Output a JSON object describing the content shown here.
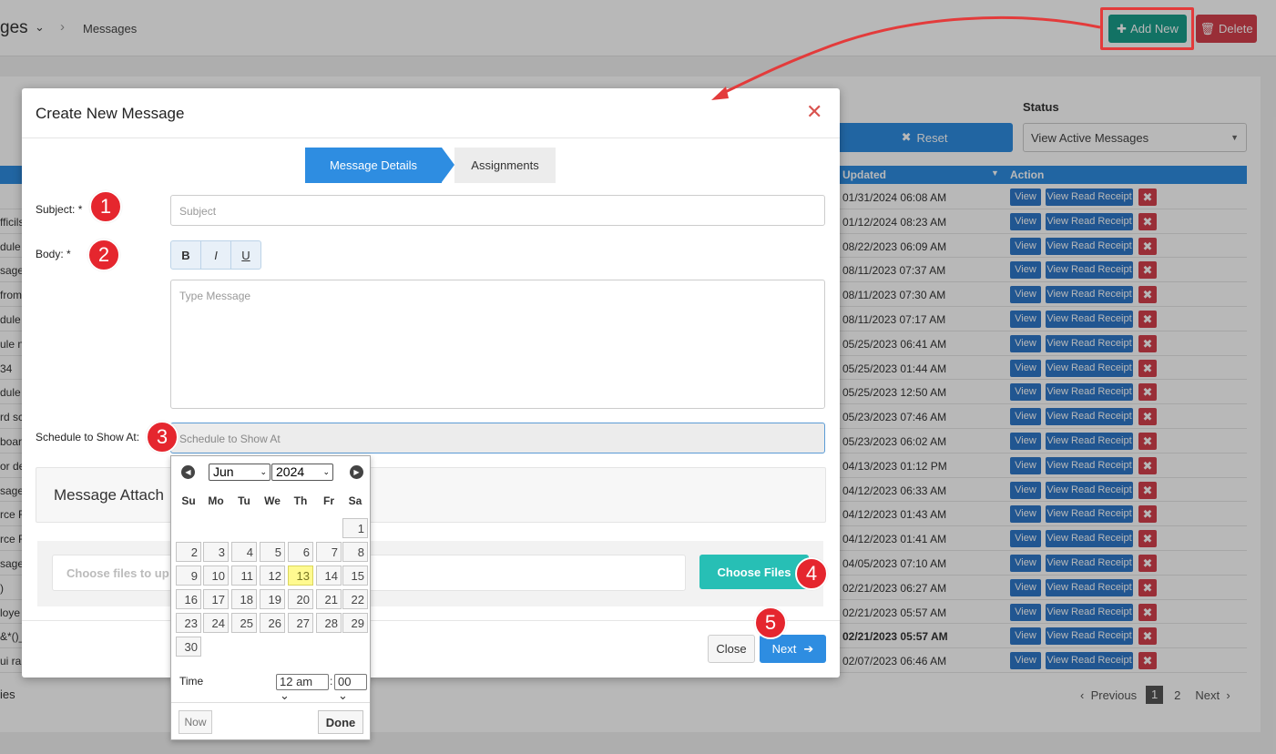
{
  "breadcrumb": {
    "title_partial": "ges",
    "current": "Messages"
  },
  "toolbar": {
    "add_new": "Add New",
    "delete": "Delete"
  },
  "filters": {
    "reset": "Reset",
    "status_label": "Status",
    "status_value": "View Active Messages"
  },
  "table": {
    "headers": {
      "updated": "Updated",
      "action": "Action"
    },
    "rows": [
      {
        "partial": "",
        "updated": "01/31/2024 06:08 AM",
        "bold": false
      },
      {
        "partial": "fficils",
        "updated": "01/12/2024 08:23 AM",
        "bold": false
      },
      {
        "partial": "dule",
        "updated": "08/22/2023 06:09 AM",
        "bold": false
      },
      {
        "partial": "sage",
        "updated": "08/11/2023 07:37 AM",
        "bold": false
      },
      {
        "partial": "from",
        "updated": "08/11/2023 07:30 AM",
        "bold": false
      },
      {
        "partial": "dule",
        "updated": "08/11/2023 07:17 AM",
        "bold": false
      },
      {
        "partial": "ule n",
        "updated": "05/25/2023 06:41 AM",
        "bold": false
      },
      {
        "partial": "34",
        "updated": "05/25/2023 01:44 AM",
        "bold": false
      },
      {
        "partial": "dule",
        "updated": "05/25/2023 12:50 AM",
        "bold": false
      },
      {
        "partial": "rd sc",
        "updated": "05/23/2023 07:46 AM",
        "bold": false
      },
      {
        "partial": "boar",
        "updated": "05/23/2023 06:02 AM",
        "bold": false
      },
      {
        "partial": "or de",
        "updated": "04/13/2023 01:12 PM",
        "bold": false
      },
      {
        "partial": "sage",
        "updated": "04/12/2023 06:33 AM",
        "bold": false
      },
      {
        "partial": "rce F",
        "updated": "04/12/2023 01:43 AM",
        "bold": false
      },
      {
        "partial": "rce F",
        "updated": "04/12/2023 01:41 AM",
        "bold": false
      },
      {
        "partial": "sage",
        "updated": "04/05/2023 07:10 AM",
        "bold": false
      },
      {
        "partial": ")",
        "updated": "02/21/2023 06:27 AM",
        "bold": false
      },
      {
        "partial": "loye",
        "updated": "02/21/2023 05:57 AM",
        "bold": false
      },
      {
        "partial": "&*()_",
        "updated": "02/21/2023 05:57 AM",
        "bold": true
      },
      {
        "partial": "ui ra",
        "updated": "02/07/2023 06:46 AM",
        "bold": false
      }
    ],
    "view_label": "View",
    "receipt_label": "View Read Receipt",
    "delete_glyph": "✖"
  },
  "footer": {
    "entries_partial": "ies",
    "previous": "Previous",
    "page1": "1",
    "page2": "2",
    "next": "Next"
  },
  "modal": {
    "title": "Create New Message",
    "steps": [
      "Message Details",
      "Assignments"
    ],
    "subject_label": "Subject: *",
    "subject_placeholder": "Subject",
    "body_label": "Body: *",
    "format": [
      "B",
      "I",
      "U"
    ],
    "body_placeholder": "Type Message",
    "schedule_label": "Schedule to Show At:",
    "schedule_placeholder": "Schedule to Show At",
    "attach_title": "Message Attach",
    "upload_placeholder": "Choose files to up",
    "choose_files": "Choose Files",
    "close": "Close",
    "next": "Next"
  },
  "badges": [
    "1",
    "2",
    "3",
    "4",
    "5"
  ],
  "datepicker": {
    "month": "Jun",
    "year": "2024",
    "dow": [
      "Su",
      "Mo",
      "Tu",
      "We",
      "Th",
      "Fr",
      "Sa"
    ],
    "days": [
      "1",
      "2",
      "3",
      "4",
      "5",
      "6",
      "7",
      "8",
      "9",
      "10",
      "11",
      "12",
      "13",
      "14",
      "15",
      "16",
      "17",
      "18",
      "19",
      "20",
      "21",
      "22",
      "23",
      "24",
      "25",
      "26",
      "27",
      "28",
      "29",
      "30"
    ],
    "first_weekday": 6,
    "today": "13",
    "time_label": "Time",
    "hour": "12 am",
    "minute": "00",
    "now": "Now",
    "done": "Done"
  },
  "colors": {
    "primary": "#2e8de1",
    "teal": "#199f8b",
    "danger": "#d5404d",
    "badge": "#e5262e",
    "annotation": "#e33b3b"
  }
}
